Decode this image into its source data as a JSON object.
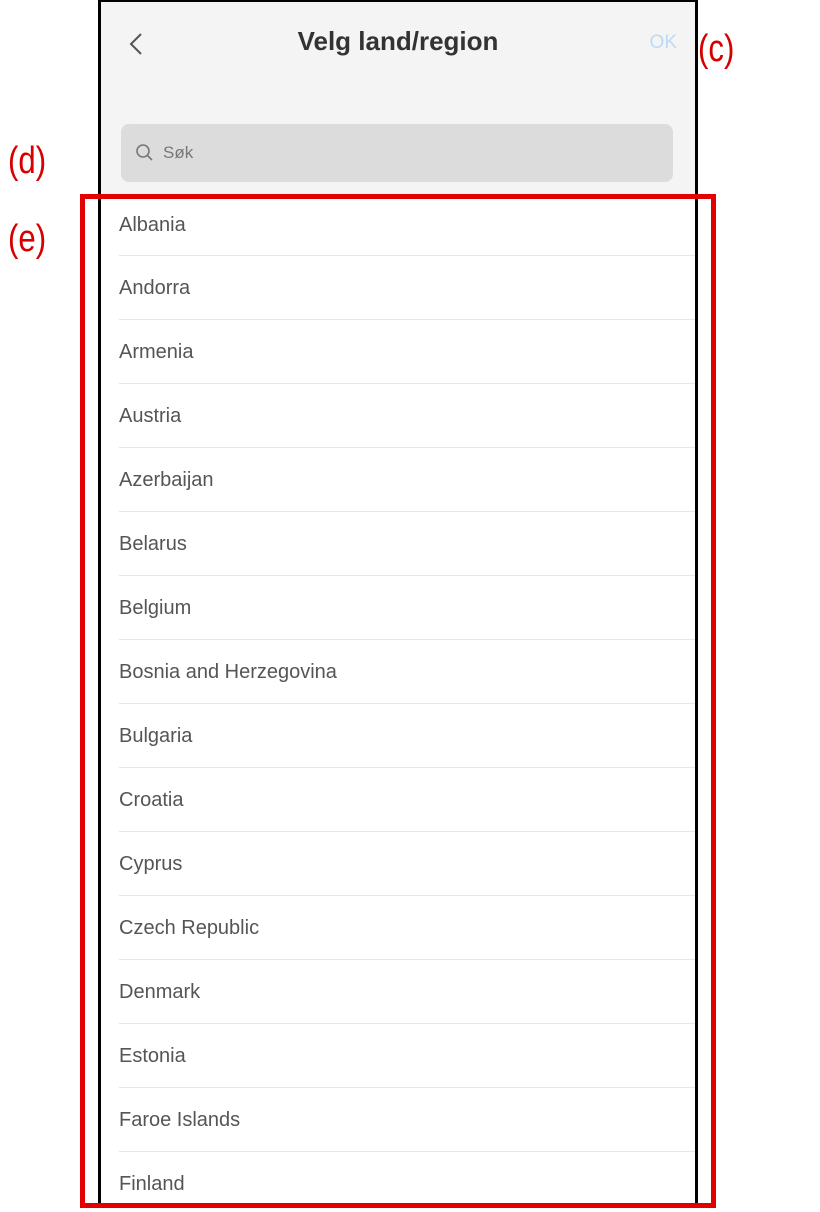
{
  "header": {
    "title": "Velg land/region",
    "ok_label": "OK"
  },
  "search": {
    "placeholder": "Søk"
  },
  "countries": [
    "Albania",
    "Andorra",
    "Armenia",
    "Austria",
    "Azerbaijan",
    "Belarus",
    "Belgium",
    "Bosnia and Herzegovina",
    "Bulgaria",
    "Croatia",
    "Cyprus",
    "Czech Republic",
    "Denmark",
    "Estonia",
    "Faroe Islands",
    "Finland"
  ],
  "annotations": {
    "c": "(c)",
    "d": "(d)",
    "e": "(e)"
  },
  "colors": {
    "annotation": "#e30000",
    "ok_disabled": "#bcd9f5",
    "header_bg": "#f4f4f4"
  }
}
